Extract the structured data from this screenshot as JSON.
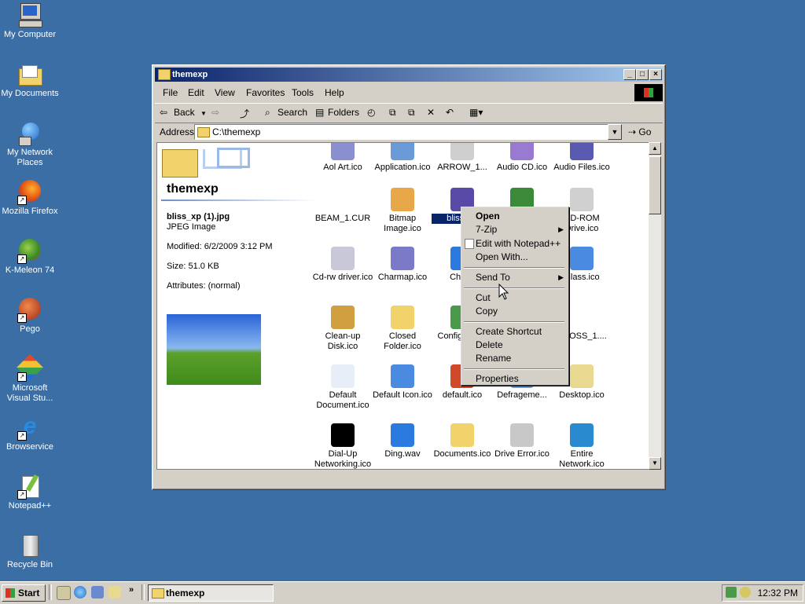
{
  "desktop": {
    "icons": [
      {
        "label": "My Computer",
        "shortcut": false
      },
      {
        "label": "My Documents",
        "shortcut": false
      },
      {
        "label": "My Network Places",
        "shortcut": false
      },
      {
        "label": "Mozilla Firefox",
        "shortcut": true
      },
      {
        "label": "K-Meleon 74",
        "shortcut": true
      },
      {
        "label": "Pego",
        "shortcut": true
      },
      {
        "label": "Microsoft Visual Stu...",
        "shortcut": true
      },
      {
        "label": "Browservice",
        "shortcut": true
      },
      {
        "label": "Notepad++",
        "shortcut": true
      },
      {
        "label": "Recycle Bin",
        "shortcut": false
      }
    ]
  },
  "window": {
    "title": "themexp",
    "menu": [
      "File",
      "Edit",
      "View",
      "Favorites",
      "Tools",
      "Help"
    ],
    "toolbar": {
      "back": "Back",
      "search": "Search",
      "folders": "Folders"
    },
    "address": {
      "label": "Address",
      "value": "C:\\themexp",
      "go": "Go"
    }
  },
  "pane": {
    "title": "themexp",
    "filename": "bliss_xp (1).jpg",
    "filetype": "JPEG Image",
    "modified": "Modified: 6/2/2009 3:12 PM",
    "size": "Size: 51.0 KB",
    "attributes": "Attributes: (normal)"
  },
  "files": [
    {
      "label": "Aol Art.ico",
      "color": "#8a8fd0"
    },
    {
      "label": "Application.ico",
      "color": "#6a9ad8"
    },
    {
      "label": "ARROW_1...",
      "color": "#cfcfcf"
    },
    {
      "label": "Audio CD.ico",
      "color": "#9a7ad0"
    },
    {
      "label": "Audio Files.ico",
      "color": "#5a5ab0"
    },
    {
      "label": "BEAM_1.CUR",
      "color": "#ffffff"
    },
    {
      "label": "Bitmap Image.ico",
      "color": "#e8a84a"
    },
    {
      "label": "bliss_xp",
      "color": "#5a4aa8",
      "selected": true
    },
    {
      "label": "",
      "color": "#3a8a3a"
    },
    {
      "label": "CD-ROM Drive.ico",
      "color": "#d0d0d0"
    },
    {
      "label": "Cd-rw driver.ico",
      "color": "#c8c8d8"
    },
    {
      "label": "Charmap.ico",
      "color": "#7a7ac8"
    },
    {
      "label": "Chime",
      "color": "#2a7ae0"
    },
    {
      "label": "",
      "color": "#ffffff"
    },
    {
      "label": "Glass.ico",
      "color": "#4a8ae0"
    },
    {
      "label": "Clean-up Disk.ico",
      "color": "#d0a040"
    },
    {
      "label": "Closed Folder.ico",
      "color": "#f2d36b"
    },
    {
      "label": "Config Settin",
      "color": "#4a9a4a"
    },
    {
      "label": "",
      "color": "#ffffff"
    },
    {
      "label": "CROSS_1....",
      "color": "#ffffff"
    },
    {
      "label": "Default Document.ico",
      "color": "#e8eef8"
    },
    {
      "label": "Default Icon.ico",
      "color": "#4a8ae0"
    },
    {
      "label": "default.ico",
      "color": "#d04a2a"
    },
    {
      "label": "Defrageme...",
      "color": "#6a9ad8"
    },
    {
      "label": "Desktop.ico",
      "color": "#e8d890"
    },
    {
      "label": "Dial-Up Networking.ico",
      "color": "#000000"
    },
    {
      "label": "Ding.wav",
      "color": "#2a7ae0"
    },
    {
      "label": "Documents.ico",
      "color": "#f2d36b"
    },
    {
      "label": "Drive Error.ico",
      "color": "#c8c8c8"
    },
    {
      "label": "Entire Network.ico",
      "color": "#2a8ad0"
    }
  ],
  "context_menu": {
    "items": [
      "Open",
      "7-Zip",
      "Edit with Notepad++",
      "Open With...",
      "Send To",
      "Cut",
      "Copy",
      "Create Shortcut",
      "Delete",
      "Rename",
      "Properties"
    ]
  },
  "taskbar": {
    "start": "Start",
    "window_button": "themexp",
    "clock": "12:32 PM"
  }
}
